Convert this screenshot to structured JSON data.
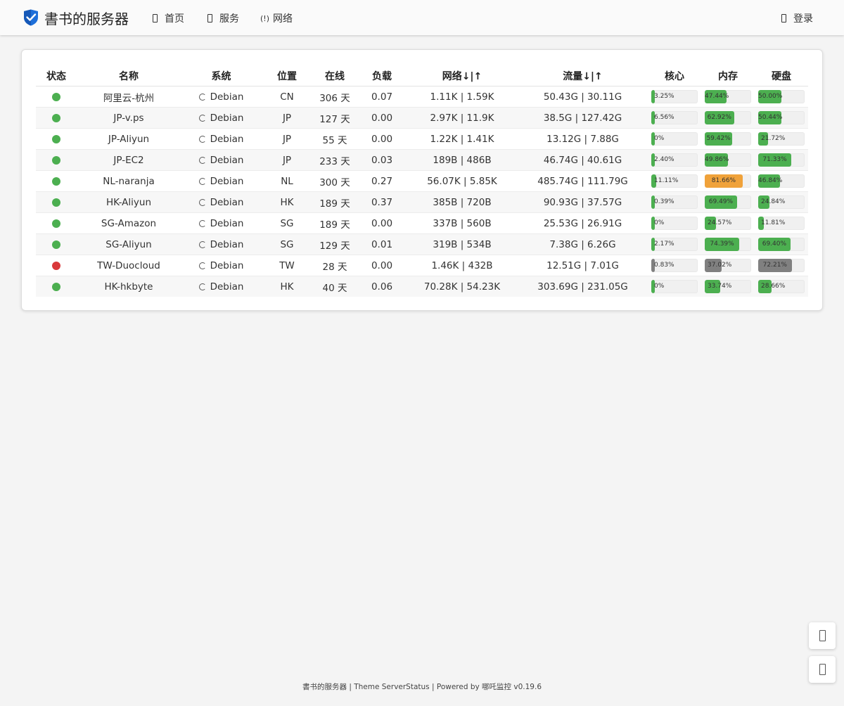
{
  "app": {
    "brand_name": "書书的服务器",
    "brand_color": "#1e6fd9"
  },
  "nav": {
    "home_label": "首页",
    "service_label": "服务",
    "network_label": "网络",
    "network_icon_text": "(!)",
    "login_label": "登录"
  },
  "table": {
    "headers": [
      "状态",
      "名称",
      "系统",
      "位置",
      "在线",
      "负载",
      "网络↓|↑",
      "流量↓|↑",
      "核心",
      "内存",
      "硬盘"
    ],
    "rows": [
      {
        "status": "online",
        "name": "阿里云-杭州",
        "os": "Debian",
        "loc": "CN",
        "uptime": "306 天",
        "load": "0.07",
        "net": "1.11K | 1.59K",
        "traffic": "50.43G | 30.11G",
        "cpu": "3.25%",
        "mem": "47.44%",
        "disk": "50.00%",
        "cpu_pct": 3.25,
        "mem_pct": 47.44,
        "disk_pct": 50.0
      },
      {
        "status": "online",
        "name": "JP-v.ps",
        "os": "Debian",
        "loc": "JP",
        "uptime": "127 天",
        "load": "0.00",
        "net": "2.97K | 11.9K",
        "traffic": "38.5G | 127.42G",
        "cpu": "6.56%",
        "mem": "62.92%",
        "disk": "50.44%",
        "cpu_pct": 6.56,
        "mem_pct": 62.92,
        "disk_pct": 50.44
      },
      {
        "status": "online",
        "name": "JP-Aliyun",
        "os": "Debian",
        "loc": "JP",
        "uptime": "55 天",
        "load": "0.00",
        "net": "1.22K | 1.41K",
        "traffic": "13.12G | 7.88G",
        "cpu": "0%",
        "mem": "59.42%",
        "disk": "21.72%",
        "cpu_pct": 0,
        "mem_pct": 59.42,
        "disk_pct": 21.72
      },
      {
        "status": "online",
        "name": "JP-EC2",
        "os": "Debian",
        "loc": "JP",
        "uptime": "233 天",
        "load": "0.03",
        "net": "189B | 486B",
        "traffic": "46.74G | 40.61G",
        "cpu": "2.40%",
        "mem": "49.86%",
        "disk": "71.33%",
        "cpu_pct": 2.4,
        "mem_pct": 49.86,
        "disk_pct": 71.33
      },
      {
        "status": "online",
        "name": "NL-naranja",
        "os": "Debian",
        "loc": "NL",
        "uptime": "300 天",
        "load": "0.27",
        "net": "56.07K | 5.85K",
        "traffic": "485.74G | 111.79G",
        "cpu": "11.11%",
        "mem": "81.66%",
        "disk": "46.84%",
        "cpu_pct": 11.11,
        "mem_pct": 81.66,
        "disk_pct": 46.84
      },
      {
        "status": "online",
        "name": "HK-Aliyun",
        "os": "Debian",
        "loc": "HK",
        "uptime": "189 天",
        "load": "0.37",
        "net": "385B | 720B",
        "traffic": "90.93G | 37.57G",
        "cpu": "0.39%",
        "mem": "69.49%",
        "disk": "24.84%",
        "cpu_pct": 0.39,
        "mem_pct": 69.49,
        "disk_pct": 24.84
      },
      {
        "status": "online",
        "name": "SG-Amazon",
        "os": "Debian",
        "loc": "SG",
        "uptime": "189 天",
        "load": "0.00",
        "net": "337B | 560B",
        "traffic": "25.53G | 26.91G",
        "cpu": "0%",
        "mem": "24.57%",
        "disk": "11.81%",
        "cpu_pct": 0,
        "mem_pct": 24.57,
        "disk_pct": 11.81
      },
      {
        "status": "online",
        "name": "SG-Aliyun",
        "os": "Debian",
        "loc": "SG",
        "uptime": "129 天",
        "load": "0.01",
        "net": "319B | 534B",
        "traffic": "7.38G | 6.26G",
        "cpu": "2.17%",
        "mem": "74.39%",
        "disk": "69.40%",
        "cpu_pct": 2.17,
        "mem_pct": 74.39,
        "disk_pct": 69.4
      },
      {
        "status": "offline",
        "name": "TW-Duocloud",
        "os": "Debian",
        "loc": "TW",
        "uptime": "28 天",
        "load": "0.00",
        "net": "1.46K | 432B",
        "traffic": "12.51G | 7.01G",
        "cpu": "0.83%",
        "mem": "37.02%",
        "disk": "72.21%",
        "cpu_pct": 0.83,
        "mem_pct": 37.02,
        "disk_pct": 72.21
      },
      {
        "status": "online",
        "name": "HK-hkbyte",
        "os": "Debian",
        "loc": "HK",
        "uptime": "40 天",
        "load": "0.06",
        "net": "70.28K | 54.23K",
        "traffic": "303.69G | 231.05G",
        "cpu": "0%",
        "mem": "33.74%",
        "disk": "28.66%",
        "cpu_pct": 0,
        "mem_pct": 33.74,
        "disk_pct": 28.66
      }
    ]
  },
  "colors": {
    "online": "#4caf50",
    "offline": "#d9383a",
    "bar_ok": "#4caf50",
    "bar_warn": "#f0a23a",
    "bar_offline": "#808080"
  },
  "footer": {
    "text": "書书的服务器 | Theme ServerStatus | Powered by 哪吒监控 v0.19.6"
  }
}
